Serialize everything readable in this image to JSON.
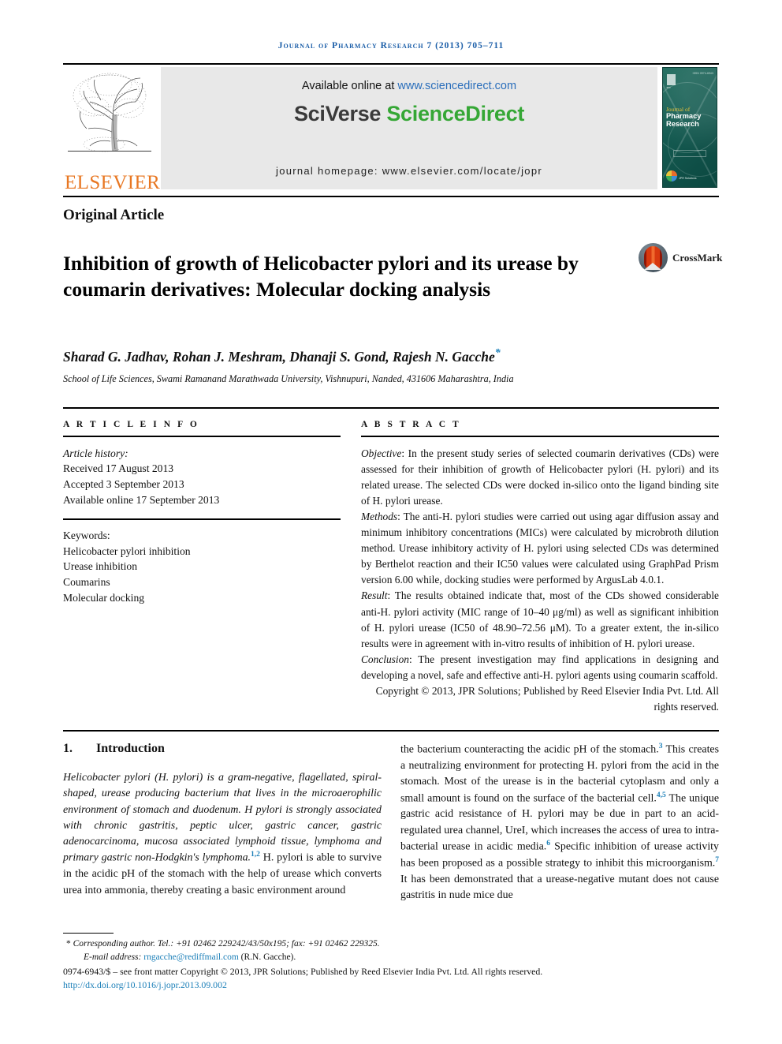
{
  "running_head": "Journal of Pharmacy Research 7 (2013) 705–711",
  "masthead": {
    "publisher_logo_text": "ELSEVIER",
    "available_online_prefix": "Available online at ",
    "available_online_url": "www.sciencedirect.com",
    "brand_first": "SciVerse ",
    "brand_second": "ScienceDirect",
    "journal_homepage": "journal homepage: www.elsevier.com/locate/jopr",
    "cover": {
      "top_note": "ISSN 0974-6943",
      "emblem_label": "JPR",
      "journal_of": "Journal of",
      "journal_title": "Pharmacy Research",
      "badge_label": "JPR Solutions"
    },
    "colors": {
      "elsevier_orange": "#e87722",
      "sciencedirect_green": "#35a735",
      "link_blue": "#2a6ebb",
      "cover_teal": "#155c52"
    }
  },
  "article": {
    "type": "Original Article",
    "title": "Inhibition of growth of Helicobacter pylori and its urease by coumarin derivatives: Molecular docking analysis",
    "crossmark_label": "CrossMark",
    "authors": "Sharad G. Jadhav, Rohan J. Meshram, Dhanaji S. Gond, Rajesh N. Gacche",
    "author_footnote_marker": "*",
    "affiliation": "School of Life Sciences, Swami Ramanand Marathwada University, Vishnupuri, Nanded, 431606 Maharashtra, India"
  },
  "article_info": {
    "heading": "A R T I C L E   I N F O",
    "history_label": "Article history:",
    "history": [
      "Received 17 August 2013",
      "Accepted 3 September 2013",
      "Available online 17 September 2013"
    ],
    "keywords_label": "Keywords:",
    "keywords": [
      "Helicobacter pylori inhibition",
      "Urease inhibition",
      "Coumarins",
      "Molecular docking"
    ]
  },
  "abstract": {
    "heading": "A B S T R A C T",
    "objective_label": "Objective",
    "objective_text": ": In the present study series of selected coumarin derivatives (CDs) were assessed for their inhibition of growth of Helicobacter pylori (H. pylori) and its related urease. The selected CDs were docked in-silico onto the ligand binding site of H. pylori urease.",
    "methods_label": "Methods",
    "methods_text": ": The anti-H. pylori studies were carried out using agar diffusion assay and minimum inhibitory concentrations (MICs) were calculated by microbroth dilution method. Urease inhibitory activity of H. pylori using selected CDs was determined by Berthelot reaction and their IC50 values were calculated using GraphPad Prism version 6.00 while, docking studies were performed by ArgusLab 4.0.1.",
    "result_label": "Result",
    "result_text": ": The results obtained indicate that, most of the CDs showed considerable anti-H. pylori activity (MIC range of 10–40 μg/ml) as well as significant inhibition of H. pylori urease (IC50 of 48.90–72.56 μM). To a greater extent, the in-silico results were in agreement with in-vitro results of inhibition of H. pylori urease.",
    "conclusion_label": "Conclusion",
    "conclusion_text": ": The present investigation may find applications in designing and developing a novel, safe and effective anti-H. pylori agents using coumarin scaffold.",
    "copyright": "Copyright © 2013, JPR Solutions; Published by Reed Elsevier India Pvt. Ltd. All rights reserved."
  },
  "introduction": {
    "number": "1.",
    "heading": "Introduction",
    "left_paragraph": "Helicobacter pylori (H. pylori) is a gram-negative, flagellated, spiral-shaped, urease producing bacterium that lives in the microaerophilic environment of stomach and duodenum. H pylori is strongly associated with chronic gastritis, peptic ulcer, gastric cancer, gastric adenocarcinoma, mucosa associated lymphoid tissue, lymphoma and primary gastric non-Hodgkin's lymphoma.",
    "left_ref1": "1,2",
    "left_paragraph_cont": " H. pylori is able to survive in the acidic pH of the stomach with the help of urease which converts urea into ammonia, thereby creating a basic environment around",
    "right_part1": "the bacterium counteracting the acidic pH of the stomach.",
    "right_ref1": "3",
    "right_part2": " This creates a neutralizing environment for protecting H. pylori from the acid in the stomach. Most of the urease is in the bacterial cytoplasm and only a small amount is found on the surface of the bacterial cell.",
    "right_ref2": "4,5",
    "right_part3": " The unique gastric acid resistance of H. pylori may be due in part to an acid-regulated urea channel, UreI, which increases the access of urea to intra-bacterial urease in acidic media.",
    "right_ref3": "6",
    "right_part4": " Specific inhibition of urease activity has been proposed as a possible strategy to inhibit this microorganism.",
    "right_ref4": "7",
    "right_part5": " It has been demonstrated that a urease-negative mutant does not cause gastritis in nude mice due"
  },
  "footer": {
    "corresponding_marker": "*",
    "corresponding": "Corresponding author. Tel.: +91 02462 229242/43/50x195; fax: +91 02462 229325.",
    "email_label": "E-mail address: ",
    "email": "rngacche@rediffmail.com",
    "email_suffix": " (R.N. Gacche).",
    "issn_line": "0974-6943/$ – see front matter Copyright © 2013, JPR Solutions; Published by Reed Elsevier India Pvt. Ltd. All rights reserved.",
    "doi": "http://dx.doi.org/10.1016/j.jopr.2013.09.002"
  }
}
